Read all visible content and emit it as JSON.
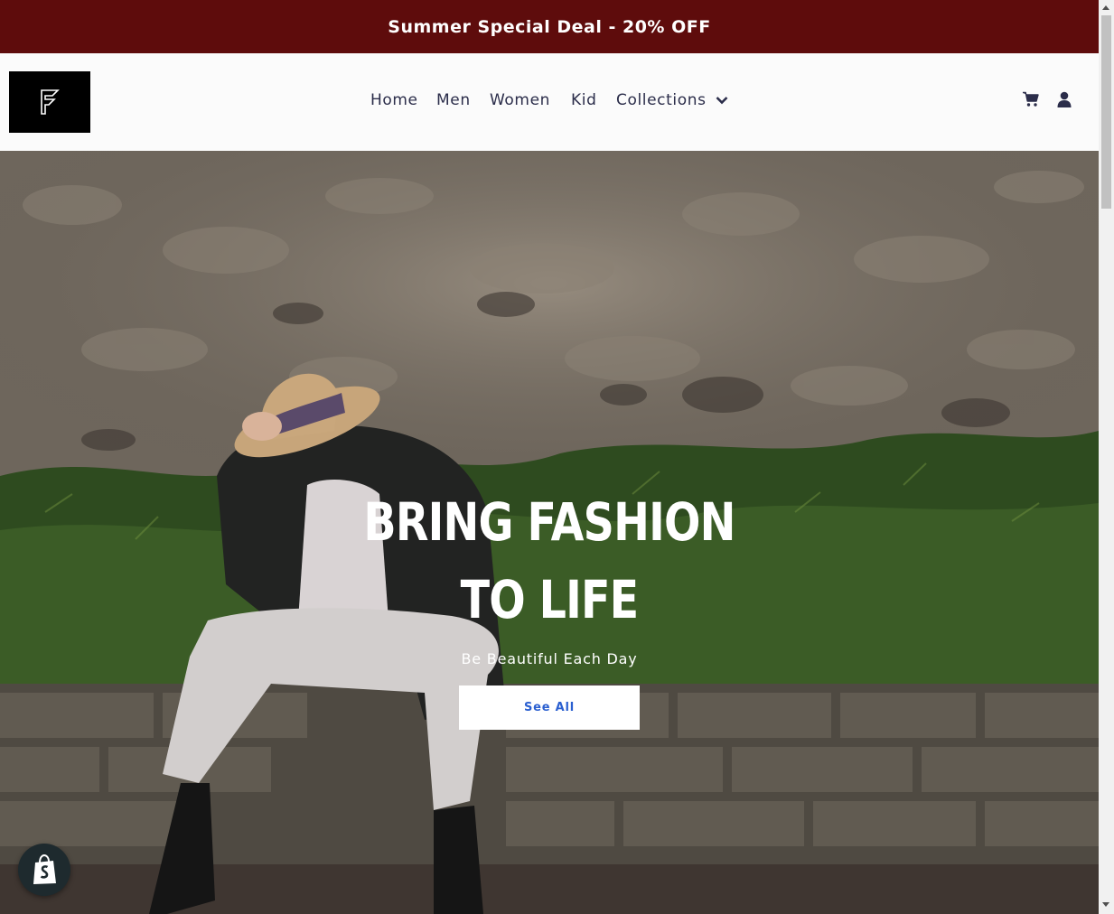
{
  "announcement": {
    "text": "Summer Special Deal - 20% OFF",
    "bg_color": "#5e0c0c"
  },
  "header": {
    "logo_icon": "brand-logo-icon",
    "nav": [
      {
        "label": "Home"
      },
      {
        "label": "Men"
      },
      {
        "label": "Women"
      },
      {
        "label": "Kid"
      },
      {
        "label": "Collections",
        "icon": "chevron-down-icon"
      }
    ],
    "icons": [
      "cart-icon",
      "account-icon"
    ]
  },
  "hero": {
    "headline_line1": "BRING FASHION",
    "headline_line2": "TO LIFE",
    "tagline": "Be Beautiful Each Day",
    "cta_label": "See All",
    "cta_text_color": "#2a5fd0"
  },
  "shopify_badge": {
    "icon": "shopify-bag-icon"
  }
}
